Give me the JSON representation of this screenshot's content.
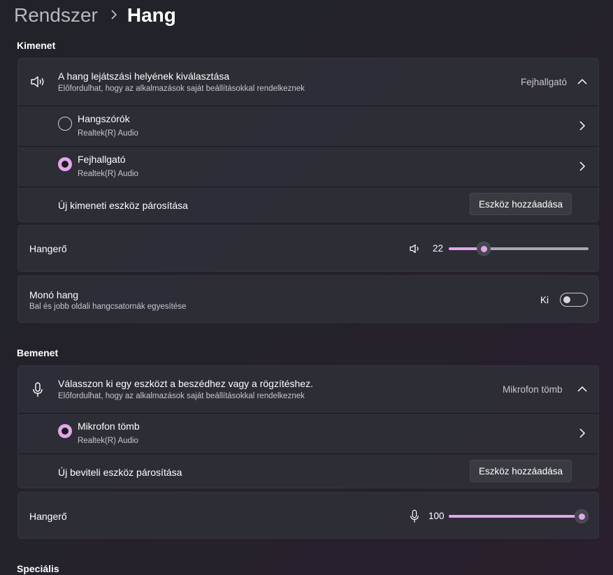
{
  "breadcrumb": {
    "parent": "Rendszer",
    "current": "Hang"
  },
  "output": {
    "section_title": "Kimenet",
    "selector": {
      "title": "A hang lejátszási helyének kiválasztása",
      "subtitle": "Előfordulhat, hogy az alkalmazások saját beállításokkal rendelkeznek",
      "selected_value": "Fejhallgató",
      "icon": "speaker-icon",
      "expanded": true
    },
    "devices": [
      {
        "name": "Hangszórók",
        "driver": "Realtek(R) Audio",
        "selected": false
      },
      {
        "name": "Fejhallgató",
        "driver": "Realtek(R) Audio",
        "selected": true
      }
    ],
    "pair": {
      "label": "Új kimeneti eszköz párosítása",
      "button": "Eszköz hozzáadása"
    },
    "volume": {
      "label": "Hangerő",
      "value": "22",
      "fraction": 0.22,
      "icon": "speaker-icon"
    },
    "mono": {
      "title": "Monó hang",
      "subtitle": "Bal és jobb oldali hangcsatornák egyesítése",
      "state_label": "Ki",
      "on": false
    }
  },
  "input": {
    "section_title": "Bemenet",
    "selector": {
      "title": "Válasszon ki egy eszközt a beszédhez vagy a rögzítéshez.",
      "subtitle": "Előfordulhat, hogy az alkalmazások saját beállításokkal rendelkeznek",
      "selected_value": "Mikrofon tömb",
      "icon": "microphone-icon",
      "expanded": true
    },
    "devices": [
      {
        "name": "Mikrofon tömb",
        "driver": "Realtek(R) Audio",
        "selected": true
      }
    ],
    "pair": {
      "label": "Új beviteli eszköz párosítása",
      "button": "Eszköz hozzáadása"
    },
    "volume": {
      "label": "Hangerő",
      "value": "100",
      "fraction": 1.0,
      "icon": "microphone-icon"
    }
  },
  "advanced": {
    "section_title": "Speciális"
  },
  "colors": {
    "accent": "#e2a6ea",
    "background": "#202329",
    "card": "#30323a"
  }
}
